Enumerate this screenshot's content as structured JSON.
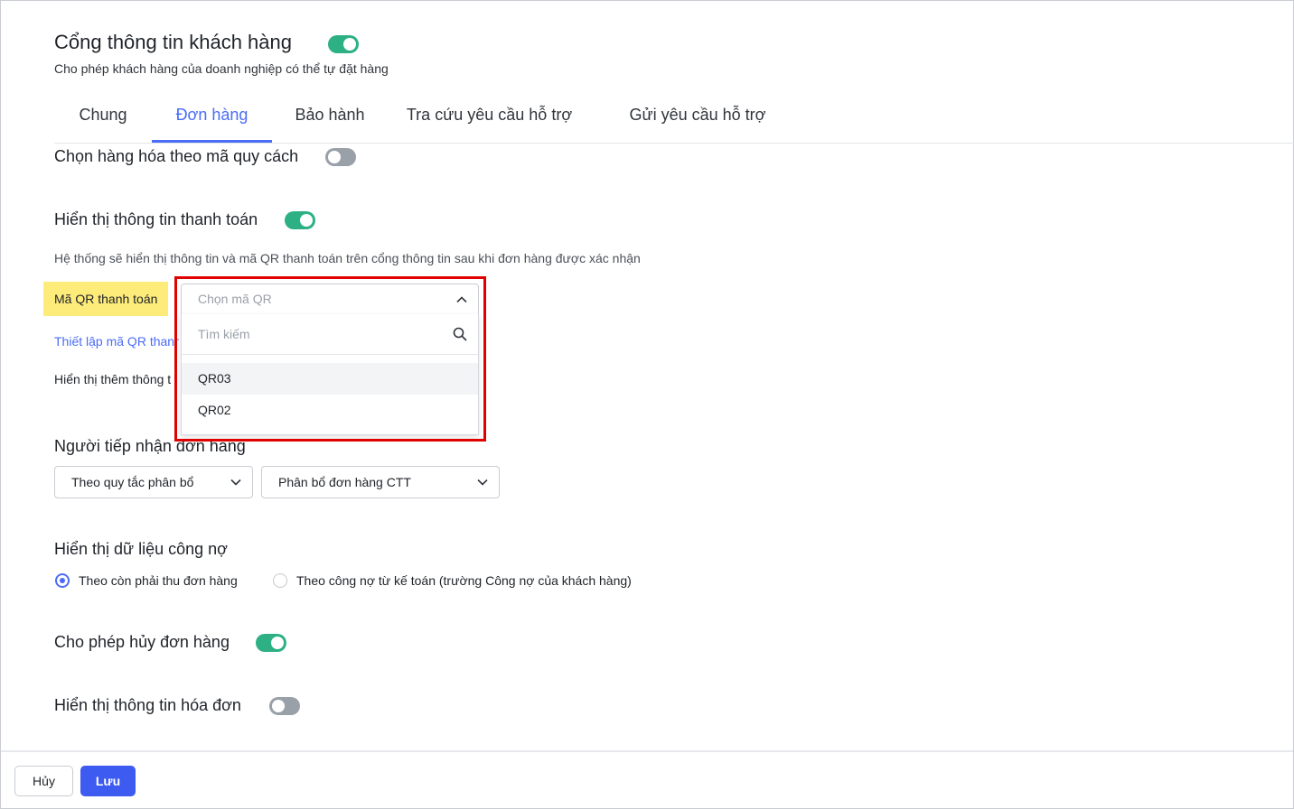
{
  "header": {
    "title": "Cổng thông tin khách hàng",
    "subtitle": "Cho phép khách hàng của doanh nghiệp có thể tự đặt hàng",
    "enabled": true
  },
  "tabs": [
    {
      "label": "Chung",
      "active": false
    },
    {
      "label": "Đơn hàng",
      "active": true
    },
    {
      "label": "Bảo hành",
      "active": false
    },
    {
      "label": "Tra cứu yêu cầu hỗ trợ",
      "active": false
    },
    {
      "label": "Gửi yêu cầu hỗ trợ",
      "active": false
    }
  ],
  "settings": {
    "spec_code": {
      "label": "Chọn hàng hóa theo mã quy cách",
      "enabled": false
    },
    "payment_info": {
      "label": "Hiển thị thông tin thanh toán",
      "enabled": true,
      "description": "Hệ thống sẽ hiển thị thông tin và mã QR thanh toán trên cổng thông tin sau khi đơn hàng được xác nhận",
      "qr_label": "Mã QR thanh toán",
      "qr_setup_link": "Thiết lập mã QR thanh",
      "extra_info_label": "Hiển thị thêm thông t"
    },
    "receiver": {
      "label": "Người tiếp nhận đơn hàng",
      "rule_select": "Theo quy tắc phân bổ",
      "allocation_select": "Phân bổ đơn hàng CTT"
    },
    "debt": {
      "label": "Hiển thị dữ liệu công nợ",
      "options": [
        {
          "label": "Theo còn phải thu đơn hàng",
          "checked": true
        },
        {
          "label": "Theo công nợ từ kế toán (trường Công nợ của khách hàng)",
          "checked": false
        }
      ]
    },
    "cancel_order": {
      "label": "Cho phép hủy đơn hàng",
      "enabled": true
    },
    "invoice_info": {
      "label": "Hiển thị thông tin hóa đơn",
      "enabled": false
    }
  },
  "qr_dropdown": {
    "placeholder": "Chọn mã QR",
    "search_placeholder": "Tìm kiếm",
    "options": [
      "QR03",
      "QR02"
    ],
    "highlight_color": "#e00000"
  },
  "footer": {
    "cancel_label": "Hủy",
    "save_label": "Lưu"
  },
  "colors": {
    "accent": "#4a6cf7",
    "toggle_on": "#2db084",
    "toggle_off": "#9aa0a8",
    "save_button": "#3d5af1",
    "label_highlight": "#fdec7a"
  }
}
